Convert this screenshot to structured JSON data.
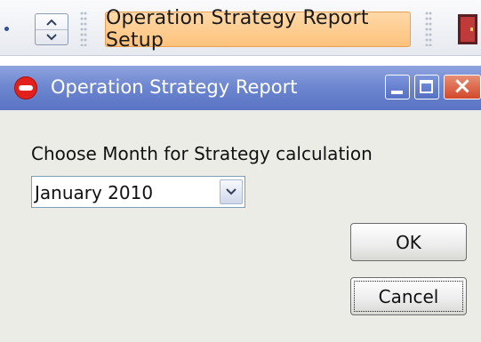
{
  "toolbar": {
    "report_setup_label": "Operation Strategy Report Setup",
    "icons": [
      "spin-up-icon",
      "spin-down-icon",
      "toolbar-grip-icon",
      "exit-door-icon"
    ]
  },
  "dialog": {
    "title": "Operation Strategy Report",
    "prompt": "Choose Month for Strategy calculation",
    "month_select": {
      "value": "January 2010"
    },
    "ok_label": "OK",
    "cancel_label": "Cancel"
  },
  "colors": {
    "title_bar": "#6e87d0",
    "setup_button": "#fcc27c",
    "close_button": "#d2482a",
    "dialog_bg": "#ecece6"
  }
}
